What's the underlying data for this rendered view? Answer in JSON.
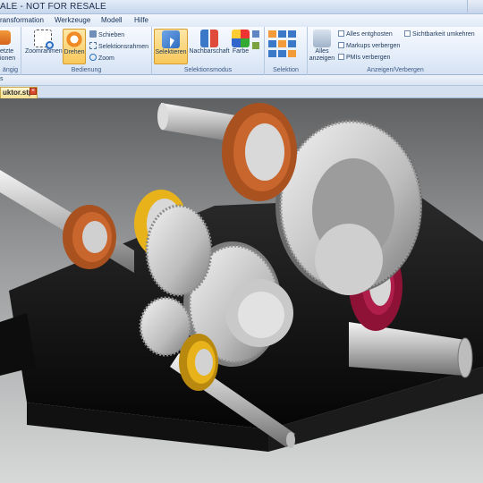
{
  "window": {
    "title": "ALE - NOT FOR RESALE"
  },
  "menu": {
    "items": [
      "ransformation",
      "Werkzeuge",
      "Modell",
      "Hilfe"
    ]
  },
  "ribbon": {
    "partial_group": {
      "line1": "etzte",
      "line2": "ionen",
      "label": "ängig"
    },
    "bedienung": {
      "label": "Bedienung",
      "zoomrahmen": "Zoomrahmen",
      "drehen": "Drehen",
      "schieben": "Schieben",
      "selektionsrahmen": "Selektionsrahmen",
      "zoom": "Zoom"
    },
    "selektionsmodus": {
      "label": "Selektionsmodus",
      "selektieren": "Selektieren",
      "nachbarschaft": "Nachbarschaft",
      "farbe": "Farbe"
    },
    "selektion": {
      "label": "Selektion"
    },
    "anzeigen": {
      "label": "Anzeigen/Verbergen",
      "alles_anzeigen_1": "Alles",
      "alles_anzeigen_2": "anzeigen",
      "alles_entghosten": "Alles entghosten",
      "markups_verbergen": "Markups verbergen",
      "pmis_verbergen": "PMIs verbergen",
      "sichtbarkeit_umkehren": "Sichtbarkeit umkehren"
    }
  },
  "strip": {
    "text": "s"
  },
  "document_tab": {
    "label": "uktor.stp"
  },
  "colors": {
    "accent_orange": "#f08a24",
    "selected": "#f8c85b",
    "ring_copper": "#c8662e",
    "ring_magenta": "#b01e4c",
    "ring_gold": "#e7b21a"
  }
}
